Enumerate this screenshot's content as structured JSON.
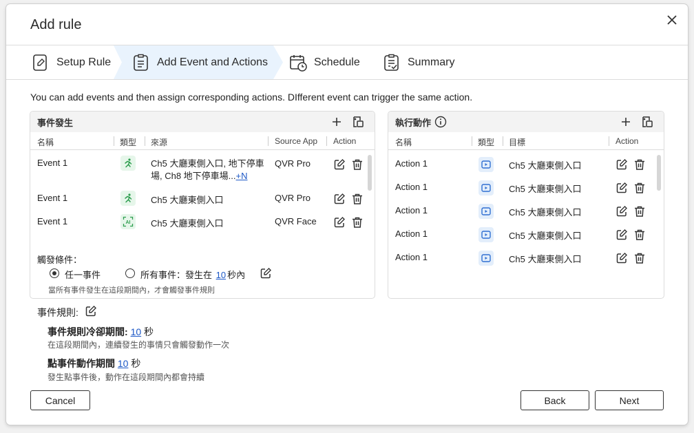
{
  "dialog": {
    "title": "Add rule",
    "close_label": "×"
  },
  "steps": [
    {
      "label": "Setup Rule",
      "icon": "edit-document-icon"
    },
    {
      "label": "Add Event and Actions",
      "icon": "list-document-icon"
    },
    {
      "label": "Schedule",
      "icon": "calendar-clock-icon"
    },
    {
      "label": "Summary",
      "icon": "checklist-icon"
    }
  ],
  "intro": "You can add events and then assign corresponding actions. DIfferent event can trigger the same action.",
  "events_panel": {
    "title": "事件發生",
    "columns": [
      "名稱",
      "類型",
      "來源",
      "Source App",
      "Action"
    ],
    "rows": [
      {
        "name": "Event 1",
        "type_icon": "running-person-icon",
        "source": "Ch5 大廳東側入口, 地下停車",
        "source_line2": "場, Ch8  地下停車場...",
        "more": "+N",
        "app": "QVR Pro"
      },
      {
        "name": "Event 1",
        "type_icon": "running-person-icon",
        "source": "Ch5 大廳東側入口",
        "app": "QVR Pro"
      },
      {
        "name": "Event 1",
        "type_icon": "ai-face-icon",
        "source": "Ch5 大廳東側入口",
        "app": "QVR Face"
      }
    ],
    "trigger_label": "觸發條件：",
    "option_any": "任一事件",
    "option_all_prefix": "所有事件：發生在",
    "option_all_value": "10",
    "option_all_suffix": "秒內",
    "option_hint": "當所有事件發生在這段期間內，才會觸發事件規則"
  },
  "actions_panel": {
    "title": "執行動作",
    "columns": [
      "名稱",
      "類型",
      "目標",
      "Action"
    ],
    "rows": [
      {
        "name": "Action 1",
        "type_icon": "video-play-icon",
        "target": "Ch5 大廳東側入口"
      },
      {
        "name": "Action 1",
        "type_icon": "video-play-icon",
        "target": "Ch5 大廳東側入口"
      },
      {
        "name": "Action 1",
        "type_icon": "video-play-icon",
        "target": "Ch5 大廳東側入口"
      },
      {
        "name": "Action 1",
        "type_icon": "video-play-icon",
        "target": "Ch5 大廳東側入口"
      },
      {
        "name": "Action 1",
        "type_icon": "video-play-icon",
        "target": "Ch5 大廳東側入口"
      }
    ]
  },
  "rules": {
    "label": "事件規則:",
    "cooldown_label": "事件規則冷卻期間:",
    "cooldown_value": "10",
    "cooldown_unit": "秒",
    "cooldown_hint": "在這段期間內，連續發生的事情只會觸發動作一次",
    "duration_label": "點事件動作期間",
    "duration_value": "10",
    "duration_unit": "秒",
    "duration_hint": "發生點事件後，動作在這段期間內都會持續"
  },
  "footer": {
    "cancel": "Cancel",
    "back": "Back",
    "next": "Next"
  },
  "colors": {
    "active_step": "#e9f3fd",
    "link": "#1b57c6",
    "green_badge": "#e6f6ea",
    "blue_badge": "#e3eefb"
  }
}
